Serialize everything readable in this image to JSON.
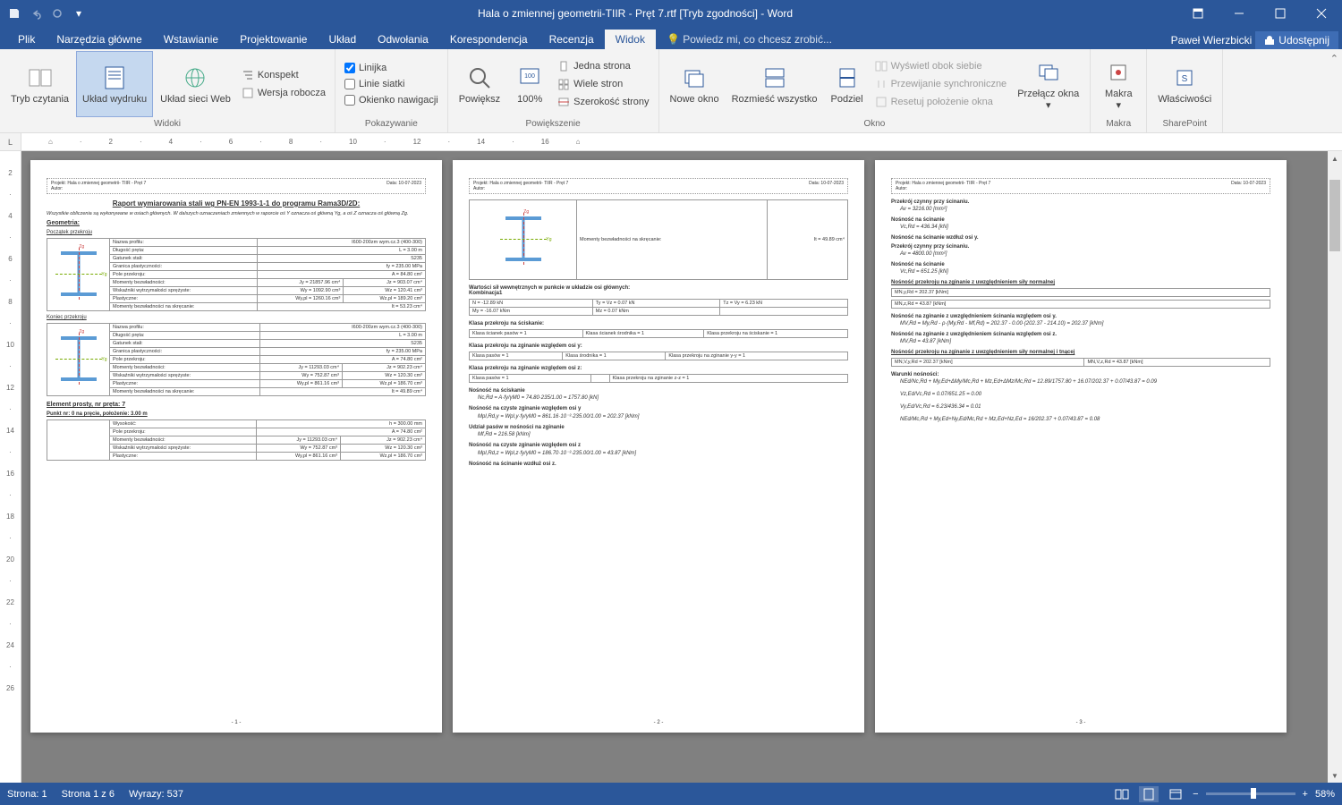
{
  "titlebar": {
    "title": "Hala o zmiennej geometrii-TIIR - Pręt 7.rtf [Tryb zgodności] - Word"
  },
  "tabs": {
    "plik": "Plik",
    "narzedzia": "Narzędzia główne",
    "wstawianie": "Wstawianie",
    "projektowanie": "Projektowanie",
    "uklad": "Układ",
    "odwolania": "Odwołania",
    "korespondencja": "Korespondencja",
    "recenzja": "Recenzja",
    "widok": "Widok",
    "tellme": "Powiedz mi, co chcesz zrobić...",
    "user": "Paweł Wierzbicki",
    "share": "Udostępnij"
  },
  "ribbon": {
    "widoki": {
      "label": "Widoki",
      "tryb_czytania": "Tryb czytania",
      "uklad_wydruku": "Układ wydruku",
      "uklad_sieci": "Układ sieci Web",
      "konspekt": "Konspekt",
      "wersja": "Wersja robocza"
    },
    "pokazywanie": {
      "label": "Pokazywanie",
      "linijka": "Linijka",
      "linie_siatki": "Linie siatki",
      "okienko": "Okienko nawigacji"
    },
    "powiekszenie": {
      "label": "Powiększenie",
      "powieksz": "Powiększ",
      "sto": "100%",
      "jedna": "Jedna strona",
      "wiele": "Wiele stron",
      "szerokosc": "Szerokość strony"
    },
    "okno": {
      "label": "Okno",
      "nowe": "Nowe okno",
      "rozmiesc": "Rozmieść wszystko",
      "podziel": "Podziel",
      "wyswieti": "Wyświetl obok siebie",
      "przewijanie": "Przewijanie synchroniczne",
      "resetuj": "Resetuj położenie okna",
      "przelacz": "Przełącz okna"
    },
    "makra": {
      "label": "Makra",
      "btn": "Makra"
    },
    "sharepoint": {
      "label": "SharePoint",
      "btn": "Właściwości"
    }
  },
  "doc": {
    "header_project": "Projekt: Hala o zmiennej geometrii- TIIR - Pręt 7",
    "header_author": "Autor:",
    "header_date": "Data: 10-07-2023",
    "page1": {
      "title": "Raport wymiarowania stali wg PN-EN 1993-1-1 do programu Rama3D/2D:",
      "note": "Wszystkie obliczenia są wykonywane w osiach głównych. W dalszych oznaczeniach zmiennych w raporcie oś Y oznacza oś główną Yg, a oś Z oznacza oś główną Zg.",
      "geo": "Geometria:",
      "poczatek": "Początek przekroju",
      "koniec": "Koniec przekroju",
      "element": "Element prosty, nr pręta: 7",
      "punkt": "Punkt nr: 0 na pręcie, położenie: 3.00 m",
      "t1": {
        "r1": [
          "Nazwa profilu:",
          "I600-200zm wym.cz.3 (400-300)"
        ],
        "r2": [
          "Długość pręta:",
          "L = 3.00 m"
        ],
        "r3": [
          "Gatunek stali:",
          "S235"
        ],
        "r4": [
          "Granica plastyczności:",
          "fy = 235.00 MPa"
        ],
        "r5": [
          "Pole przekroju:",
          "A = 84.80 cm²"
        ],
        "r6": [
          "Momenty bezwładności:",
          "Jy = 21857.96 cm⁴",
          "Jz = 903.07 cm⁴"
        ],
        "r7": [
          "Wskaźniki wytrzymałości sprężyste:",
          "Wy = 1092.90 cm³",
          "Wz = 120.41 cm³"
        ],
        "r8": [
          "Plastyczne:",
          "Wy,pl = 1260.16 cm³",
          "Wz,pl = 189.20 cm³"
        ],
        "r9": [
          "Momenty bezwładności na skręcanie:",
          "It = 53.23 cm⁴"
        ]
      },
      "t2": {
        "r1": [
          "Nazwa profilu:",
          "I600-200zm wym.cz.3 (400-300)"
        ],
        "r2": [
          "Długość pręta:",
          "L = 3.00 m"
        ],
        "r3": [
          "Gatunek stali:",
          "S235"
        ],
        "r4": [
          "Granica plastyczności:",
          "fy = 235.00 MPa"
        ],
        "r5": [
          "Pole przekroju:",
          "A = 74.80 cm²"
        ],
        "r6": [
          "Momenty bezwładności:",
          "Jy = 11293.03 cm⁴",
          "Jz = 902.23 cm⁴"
        ],
        "r7": [
          "Wskaźniki wytrzymałości sprężyste:",
          "Wy = 752.87 cm³",
          "Wz = 120.30 cm³"
        ],
        "r8": [
          "Plastyczne:",
          "Wy,pl = 861.16 cm³",
          "Wz,pl = 186.70 cm³"
        ],
        "r9": [
          "Momenty bezwładności na skręcanie:",
          "It = 49.89 cm⁴"
        ]
      },
      "t3": {
        "r1": [
          "Wysokość:",
          "h = 300.00 mm"
        ],
        "r2": [
          "Pole przekroju:",
          "A = 74.80 cm²"
        ],
        "r3": [
          "Momenty bezwładności:",
          "Jy = 11293.03 cm⁴",
          "Jz = 902.23 cm⁴"
        ],
        "r4": [
          "Wskaźniki wytrzymałości sprężyste:",
          "Wy = 752.87 cm³",
          "Wz = 120.30 cm³"
        ],
        "r5": [
          "Plastyczne:",
          "Wy,pl = 861.16 cm³",
          "Wz,pl = 186.70 cm³"
        ]
      }
    },
    "page2": {
      "mom_skr": "Momenty bezwładności na skręcanie:",
      "it_val": "It = 49.89 cm⁴",
      "wartosci": "Wartości sił wewnętrznych w punkcie w układzie osi głównych:",
      "kombinacja": "Kombinacja1",
      "sily": {
        "n": "N = -12.89 kN",
        "ty": "Ty = Vz = 0.07 kN",
        "tz": "Tz = Vy = 6.23 kN",
        "my": "My = -16.07 kNm",
        "mz": "Mz = 0.07 kNm"
      },
      "klasa_scisk": "Klasa przekroju na ściskanie:",
      "kl1": [
        "Klasa ścianek pasów = 1",
        "Klasa ścianek środnika = 1",
        "Klasa przekroju na ściskanie = 1"
      ],
      "klasa_zgy": "Klasa przekroju na zginanie względem osi y:",
      "kl2": [
        "Klasa pasów = 1",
        "Klasa środnika = 1",
        "Klasa przekroju na zginanie y-y = 1"
      ],
      "klasa_zgz": "Klasa przekroju na zginanie względem osi z:",
      "kl3": [
        "Klasa pasów = 1",
        "",
        "Klasa przekroju na zginanie z-z = 1"
      ],
      "nosc_scisk": "Nośność na ściskanie",
      "f1": "Nc,Rd = A·fy/γM0 = 74.80·235/1.00 = 1757.80 [kN]",
      "nosc_zgy": "Nośność na czyste zginanie względem osi y",
      "f2": "Mpl,Rd,y = Wpl,y·fy/γM0 = 861.16·10⁻³·235.00/1.00 = 202.37 [kNm]",
      "udzial": "Udział pasów w nośności na zginanie",
      "f3": "Mf,Rd = 216.58 [kNm]",
      "nosc_zgz": "Nośność na czyste zginanie względem osi z",
      "f4": "Mpl,Rd,z = Wpl,z·fy/γM0 = 186.70·10⁻³·235.00/1.00 = 43.87 [kNm]",
      "nosc_scin": "Nośność na ścinanie wzdłuż osi z."
    },
    "page3": {
      "h1": "Przekrój czynny przy ścinaniu.",
      "f1": "Av = 3216.00 [mm²]",
      "h2": "Nośność na ścinanie",
      "f2": "Vc,Rd = 436.34 [kN]",
      "h3": "Nośność na ścinanie wzdłuż osi y.",
      "h4": "Przekrój czynny przy ścinaniu.",
      "f3": "Av = 4800.00 [mm²]",
      "h5": "Nośność na ścinanie",
      "f4": "Vc,Rd = 651.25 [kN]",
      "h6": "Nośność przekroju na zginanie z uwzględnieniem siły normalnej",
      "t1": "MN,y,Rd = 202.37 [kNm]",
      "t2": "MN,z,Rd = 43.87 [kNm]",
      "h7": "Nośność na zginanie z uwzględnieniem ścinania względem osi y.",
      "f5": "MV,Rd = My,Rd - ρ·(My,Rd - Mf,Rd) = 202.37 - 0.00·(202.37 - 214.10) = 202.37 [kNm]",
      "h8": "Nośność na zginanie z uwzględnieniem ścinania względem osi z.",
      "f6": "MV,Rd = 43.87 [kNm]",
      "h9": "Nośność przekroju na zginanie z uwzględnieniem siły normalnej i tnącej",
      "t3a": "MN,V,y,Rd = 202.37 [kNm]",
      "t3b": "MN,V,z,Rd = 43.87 [kNm]",
      "h10": "Warunki nośności:",
      "w1": "NEd/Nc,Rd + My,Ed+ΔMy/Mc,Rd + Mz,Ed+ΔMz/Mc,Rd = 12.89/1757.80 + 16.07/202.37 + 0.07/43.87 = 0.09",
      "w2": "Vz,Ed/Vc,Rd = 0.07/651.25 = 0.00",
      "w3": "Vy,Ed/Vc,Rd = 6.23/436.34 = 0.01",
      "w4": "NEd/Mc,Rd + My,Ed+Ny,Ed/Mc,Rd + Mz,Ed+Nz,Ed = 16/202.37 + 0.07/43.87 = 0.08"
    }
  },
  "status": {
    "strona": "Strona: 1",
    "strona_z": "Strona 1 z 6",
    "wyrazy": "Wyrazy: 537",
    "zoom": "58%"
  }
}
